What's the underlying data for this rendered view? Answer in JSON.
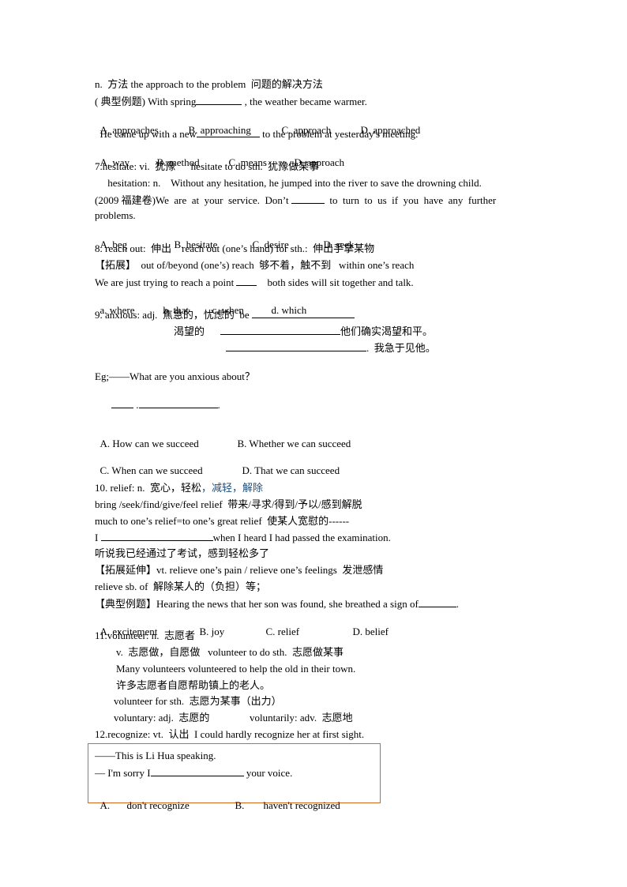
{
  "lines": {
    "l1": "n.  方法 the approach to the problem  问题的解决方法",
    "l2a": "( 典型例题) With spring",
    "l2b": " , the weather became warmer.",
    "l3": [
      "A. approaches",
      "B. approaching",
      "C. approach",
      "D. approached"
    ],
    "l4a": "  He came up with a new",
    "l4b": " to the problem at yesterday's meeting.",
    "l5": [
      "A. way",
      "B. method",
      "C. means",
      "D. approach"
    ],
    "l6": "7.hesitate: vi.  犹豫      hesitate to do sth.  犹豫做某事",
    "l7": "     hesitation: n.    Without any hesitation, he jumped into the river to save the drowning child.",
    "l8a": "(2009 福建卷)We  are  at  your  service.  Don’t ",
    "l8b": "  to  turn  to  us  if  you  have  any  further",
    "l9": "problems.",
    "l10": [
      "A. beg",
      "B. hesitate",
      "C. desire",
      "D. seek"
    ],
    "l11": "8. reach out:  伸出    reach out (one’s hand) for sth.:  伸出手拿某物",
    "l12": "【拓展】  out of/beyond (one’s) reach  够不着，触不到   within one’s reach",
    "l13a": "We are just trying to reach a point ",
    "l13b": "    both sides will sit together and talk.",
    "l14": [
      "a. where",
      "b. that",
      "c. when",
      "d. which"
    ],
    "l15": "9. anxious: adj.  焦急的，忧虑的  be ",
    "l16": "渴望的",
    "l16b": "他们确实渴望和平。",
    "l17b": ".  我急于见他。",
    "l18": "Eg;——What are you anxious about？",
    "l20": [
      "A. How can we succeed",
      "B. Whether we can succeed"
    ],
    "l21": [
      "C. When can we succeed",
      "D. That we can succeed"
    ],
    "l22a": "10. relief: n.  宽心，轻松",
    "l22b": "，减轻，解除",
    "l23": "bring /seek/find/give/feel relief  带来/寻求/得到/予以/感到解脱",
    "l24": "much to one’s relief=to one’s great relief  使某人宽慰的------",
    "l25a": "I ",
    "l25b": "when I heard I had passed the examination.",
    "l26": "听说我已经通过了考试，感到轻松多了",
    "l27": "【拓展延伸】vt. relieve one’s pain / relieve one’s feelings  发泄感情",
    "l28": "relieve sb. of  解除某人的（负担）等；",
    "l29a": "【典型例题】Hearing the news that her son was found, she breathed a sign of",
    "l29b": ".",
    "l30": [
      "A. excitement",
      "B. joy",
      "C. relief",
      "D. belief"
    ],
    "l31": "11.volunteer: n.  志愿者",
    "l32": "v.  志愿做，自愿做   volunteer to do sth.  志愿做某事",
    "l33": "Many volunteers volunteered to help the old in their town.",
    "l34": "许多志愿者自愿帮助镇上的老人。",
    "l35": "volunteer for sth.  志愿为某事（出力）",
    "l36a": "voluntary: adj.  志愿的",
    "l36b": "voluntarily: adv.  志愿地",
    "l37": "12.recognize: vt.  认出  I could hardly recognize her at first sight."
  },
  "box": {
    "b1": "——This is Li Hua speaking.",
    "b2a": "— I'm sorry I",
    "b2b": " your voice.",
    "b3": [
      "A.",
      "don't recognize",
      "B.",
      "haven't recognized"
    ]
  }
}
